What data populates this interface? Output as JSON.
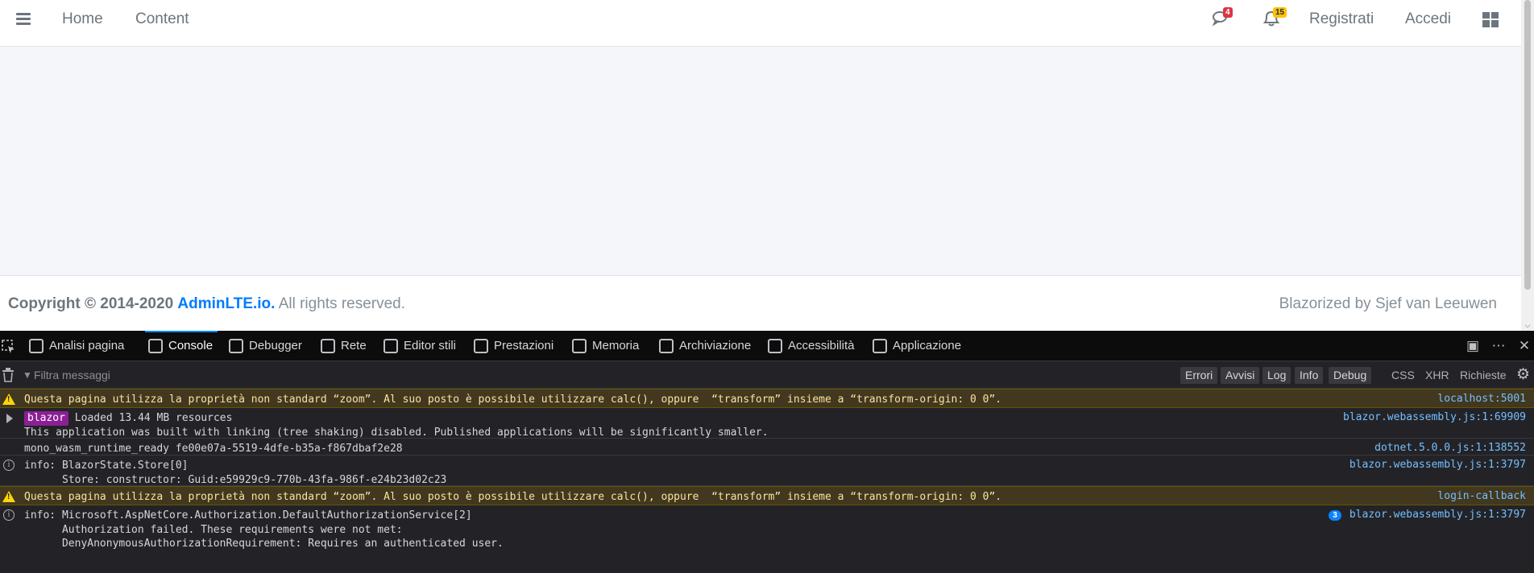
{
  "navbar": {
    "links": {
      "home": "Home",
      "content": "Content"
    },
    "messages_badge": "4",
    "notifications_badge": "15",
    "register": "Registrati",
    "login": "Accedi"
  },
  "footer": {
    "copyright": "Copyright © 2014-2020",
    "brand": "AdminLTE.io.",
    "rights": "All rights reserved.",
    "credit": "Blazorized by Sjef van Leeuwen"
  },
  "devtools": {
    "tabs": [
      {
        "label": "Analisi pagina",
        "icon": "inspector-icon"
      },
      {
        "label": "Console",
        "icon": "console-icon",
        "active": true
      },
      {
        "label": "Debugger",
        "icon": "debugger-icon"
      },
      {
        "label": "Rete",
        "icon": "network-icon"
      },
      {
        "label": "Editor stili",
        "icon": "style-editor-icon"
      },
      {
        "label": "Prestazioni",
        "icon": "performance-icon"
      },
      {
        "label": "Memoria",
        "icon": "memory-icon"
      },
      {
        "label": "Archiviazione",
        "icon": "storage-icon"
      },
      {
        "label": "Accessibilità",
        "icon": "accessibility-icon"
      },
      {
        "label": "Applicazione",
        "icon": "application-icon"
      }
    ],
    "filter": {
      "placeholder": "Filtra messaggi",
      "levels": [
        "Errori",
        "Avvisi",
        "Log",
        "Info",
        "Debug"
      ],
      "types": [
        "CSS",
        "XHR",
        "Richieste"
      ]
    },
    "messages": [
      {
        "level": "warning",
        "text": "Questa pagina utilizza la proprietà non standard “zoom”. Al suo posto è possibile utilizzare calc(), oppure  “transform” insieme a “transform-origin: 0 0”.",
        "source": "localhost:5001"
      },
      {
        "level": "log",
        "tag": "blazor",
        "text": "Loaded 13.44 MB resources",
        "detail": "This application was built with linking (tree shaking) disabled. Published applications will be significantly smaller.",
        "source": "blazor.webassembly.js:1:69909"
      },
      {
        "level": "log",
        "text": "mono_wasm_runtime_ready fe00e07a-5519-4dfe-b35a-f867dbaf2e28",
        "source": "dotnet.5.0.0.js:1:138552"
      },
      {
        "level": "info",
        "text": "info: BlazorState.Store[0]\n      Store: constructor: Guid:e59929c9-770b-43fa-986f-e24b23d02c23",
        "source": "blazor.webassembly.js:1:3797"
      },
      {
        "level": "warning",
        "text": "Questa pagina utilizza la proprietà non standard “zoom”. Al suo posto è possibile utilizzare calc(), oppure  “transform” insieme a “transform-origin: 0 0”.",
        "source": "login-callback"
      },
      {
        "level": "info",
        "text": "info: Microsoft.AspNetCore.Authorization.DefaultAuthorizationService[2]\n      Authorization failed. These requirements were not met:\n      DenyAnonymousAuthorizationRequirement: Requires an authenticated user.",
        "repeat": "3",
        "source": "blazor.webassembly.js:1:3797"
      }
    ]
  },
  "colors": {
    "link_blue": "#007bff",
    "badge_red": "#dc3545",
    "badge_yellow": "#ffc107",
    "devtools_bg": "#232327",
    "warning_bg": "#42381f",
    "source_link": "#75bfff",
    "blazor_tag": "#8c1f95"
  }
}
